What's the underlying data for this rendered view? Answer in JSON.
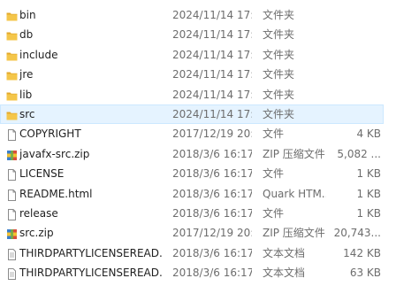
{
  "files": [
    {
      "name": "bin",
      "date": "2024/11/14 17:...",
      "type": "文件夹",
      "size": "",
      "icon": "folder-icon"
    },
    {
      "name": "db",
      "date": "2024/11/14 17:...",
      "type": "文件夹",
      "size": "",
      "icon": "folder-icon"
    },
    {
      "name": "include",
      "date": "2024/11/14 17:...",
      "type": "文件夹",
      "size": "",
      "icon": "folder-icon"
    },
    {
      "name": "jre",
      "date": "2024/11/14 17:...",
      "type": "文件夹",
      "size": "",
      "icon": "folder-icon"
    },
    {
      "name": "lib",
      "date": "2024/11/14 17:...",
      "type": "文件夹",
      "size": "",
      "icon": "folder-icon"
    },
    {
      "name": "src",
      "date": "2024/11/14 17:...",
      "type": "文件夹",
      "size": "",
      "icon": "folder-icon"
    },
    {
      "name": "COPYRIGHT",
      "date": "2017/12/19 20:...",
      "type": "文件",
      "size": "4 KB",
      "icon": "file-icon"
    },
    {
      "name": "javafx-src.zip",
      "date": "2018/3/6 16:17",
      "type": "ZIP 压缩文件",
      "size": "5,082 ...",
      "icon": "zip-archive-icon"
    },
    {
      "name": "LICENSE",
      "date": "2018/3/6 16:17",
      "type": "文件",
      "size": "1 KB",
      "icon": "file-icon"
    },
    {
      "name": "README.html",
      "date": "2018/3/6 16:17",
      "type": "Quark HTM...",
      "size": "1 KB",
      "icon": "file-icon"
    },
    {
      "name": "release",
      "date": "2018/3/6 16:17",
      "type": "文件",
      "size": "1 KB",
      "icon": "file-icon"
    },
    {
      "name": "src.zip",
      "date": "2017/12/19 20:...",
      "type": "ZIP 压缩文件",
      "size": "20,743...",
      "icon": "zip-archive-icon"
    },
    {
      "name": "THIRDPARTYLICENSEREAD...",
      "date": "2018/3/6 16:17",
      "type": "文本文档",
      "size": "142 KB",
      "icon": "text-document-icon"
    },
    {
      "name": "THIRDPARTYLICENSEREAD...",
      "date": "2018/3/6 16:17",
      "type": "文本文档",
      "size": "63 KB",
      "icon": "text-document-icon"
    }
  ],
  "hovered_row": "src",
  "colors": {
    "folder": "#f4c64a",
    "folder_dark": "#e3a92b",
    "hover_bg": "#e5f3ff",
    "hover_border": "#cce8ff",
    "secondary_text": "#6d6d6d"
  }
}
